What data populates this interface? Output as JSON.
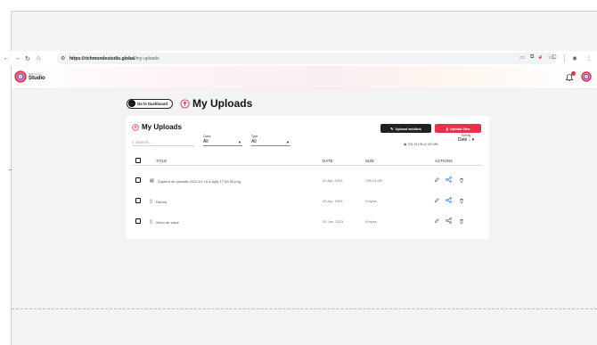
{
  "browser": {
    "url_host": "https://richmondestudio.global",
    "url_path": "/my-uploads"
  },
  "app": {
    "logo_small": "Richmond",
    "logo_big": "Studio"
  },
  "page": {
    "back_button": "Go to Dashboard",
    "title": "My Uploads"
  },
  "card": {
    "title": "My Uploads",
    "search_placeholder": "Search...",
    "filters": [
      {
        "label": "Class",
        "value": "All"
      },
      {
        "label": "Type",
        "value": "All"
      }
    ],
    "upload_weblink": "Upload weblink",
    "upload_files": "Upload files",
    "quota": "706.15 KB of 100 MB",
    "sort_label": "Sort by",
    "sort_value": "Date"
  },
  "table": {
    "headers": {
      "title": "TITLE",
      "date": "DATE",
      "size": "SIZE",
      "actions": "ACTIONS"
    },
    "rows": [
      {
        "name": "Captura de pantalla 2023-01-16 a la(s) 17.53.35.png",
        "date": "25 Apr, 2023",
        "size": "706.15 KB",
        "type": "image"
      },
      {
        "name": "History",
        "date": "25 Apr, 2023",
        "size": "0 bytes",
        "type": "doc"
      },
      {
        "name": "Video de clase",
        "date": "03 Jan, 2023",
        "size": "0 bytes",
        "type": "doc"
      }
    ]
  },
  "colors": {
    "accent": "#e8304f",
    "dark": "#222222",
    "link_blue": "#1a73e8"
  }
}
